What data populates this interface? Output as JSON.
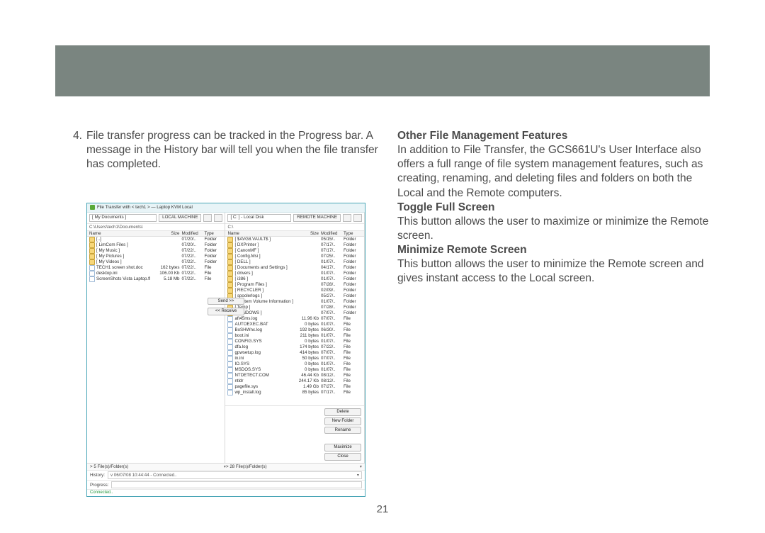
{
  "page_number": "21",
  "left_column": {
    "step_number": "4.",
    "step_text": "File transfer progress can be tracked in the Progress bar. A message in the History bar will tell you when the file transfer has completed."
  },
  "right_column": {
    "h1": "Other File Management Features",
    "p1": "In addition to File Transfer, the GCS661U's User Interface also offers a full range of file system management features, such as creating, renaming, and deleting files and folders on both the Local and the Remote computers.",
    "h2": "Toggle Full Screen",
    "p2": "This button allows the user to maximize or minimize the Remote screen.",
    "h3": "Minimize Remote Screen",
    "p3": "This button allows the user to minimize the Remote screen and gives instant access to the Local screen."
  },
  "screenshot": {
    "title": "File Transfer with < tech1 > — Laptop KVM Local",
    "headers": {
      "name": "Name",
      "size": "Size",
      "modified": "Modified",
      "type": "Type"
    },
    "center_buttons": {
      "send": "Send >>",
      "receive": "<< Receive"
    },
    "right_buttons": {
      "delete_top": "Delete",
      "newfolder": "New Folder",
      "rename": "Rename",
      "maximize": "Maximize",
      "close": "Close"
    },
    "local": {
      "dropdown": "[ My Documents ]",
      "machine_label": "LOCAL MACHINE",
      "path": "C:\\Users\\tech1\\Documents\\",
      "rows": [
        {
          "name": "[..]",
          "size": "",
          "mod": "07/20/..",
          "type": "Folder",
          "icon": "up"
        },
        {
          "name": "[ LimCom Files ]",
          "size": "",
          "mod": "07/20/..",
          "type": "Folder",
          "icon": "folder"
        },
        {
          "name": "[ My Music ]",
          "size": "",
          "mod": "07/22/..",
          "type": "Folder",
          "icon": "folder"
        },
        {
          "name": "[ My Pictures ]",
          "size": "",
          "mod": "07/22/..",
          "type": "Folder",
          "icon": "folder"
        },
        {
          "name": "[ My Videos ]",
          "size": "",
          "mod": "07/22/..",
          "type": "Folder",
          "icon": "folder"
        },
        {
          "name": "TECH1 screen shot.doc",
          "size": "162 bytes",
          "mod": "07/22/..",
          "type": "File",
          "icon": "file"
        },
        {
          "name": "desktop.ini",
          "size": "106.00 Kb",
          "mod": "07/22/..",
          "type": "File",
          "icon": "file"
        },
        {
          "name": "ScreenShots Vista Laptop.fl",
          "size": "5.18 Mb",
          "mod": "07/22/..",
          "type": "File",
          "icon": "file"
        }
      ],
      "status": "> 5 File(s)/Folder(s)"
    },
    "remote": {
      "dropdown": "[ C: ] - Local Disk",
      "machine_label": "REMOTE MACHINE",
      "path": "C:\\",
      "rows": [
        {
          "name": "[ $AVG8.VAULT$ ]",
          "size": "",
          "mod": "05/15/..",
          "type": "Folder",
          "icon": "folder"
        },
        {
          "name": "[ DXPrinter ]",
          "size": "",
          "mod": "07/17/..",
          "type": "Folder",
          "icon": "folder"
        },
        {
          "name": "[ CanonMF ]",
          "size": "",
          "mod": "07/17/..",
          "type": "Folder",
          "icon": "folder"
        },
        {
          "name": "[ Config.Msi ]",
          "size": "",
          "mod": "07/25/..",
          "type": "Folder",
          "icon": "folder"
        },
        {
          "name": "[ DELL ]",
          "size": "",
          "mod": "01/07/..",
          "type": "Folder",
          "icon": "folder"
        },
        {
          "name": "[ Documents and Settings ]",
          "size": "",
          "mod": "04/17/..",
          "type": "Folder",
          "icon": "folder"
        },
        {
          "name": "[ drivers ]",
          "size": "",
          "mod": "01/07/..",
          "type": "Folder",
          "icon": "folder"
        },
        {
          "name": "[ i386 ]",
          "size": "",
          "mod": "01/07/..",
          "type": "Folder",
          "icon": "folder"
        },
        {
          "name": "[ Program Files ]",
          "size": "",
          "mod": "07/28/..",
          "type": "Folder",
          "icon": "folder"
        },
        {
          "name": "[ RECYCLER ]",
          "size": "",
          "mod": "02/09/..",
          "type": "Folder",
          "icon": "folder"
        },
        {
          "name": "[ spoolerlogs ]",
          "size": "",
          "mod": "05/27/..",
          "type": "Folder",
          "icon": "folder"
        },
        {
          "name": "[ System Volume Information ]",
          "size": "",
          "mod": "01/07/..",
          "type": "Folder",
          "icon": "folder"
        },
        {
          "name": "[ Temp ]",
          "size": "",
          "mod": "07/28/..",
          "type": "Folder",
          "icon": "folder"
        },
        {
          "name": "[ WINDOWS ]",
          "size": "",
          "mod": "07/07/..",
          "type": "Folder",
          "icon": "folder"
        },
        {
          "name": "aft45ms.log",
          "size": "11.96 Kb",
          "mod": "07/07/..",
          "type": "File",
          "icon": "file"
        },
        {
          "name": "AUTOEXEC.BAT",
          "size": "0 bytes",
          "mod": "01/07/..",
          "type": "File",
          "icon": "file"
        },
        {
          "name": "BoSHWnx.log",
          "size": "192 bytes",
          "mod": "06/30/..",
          "type": "File",
          "icon": "file"
        },
        {
          "name": "boot.ini",
          "size": "211 bytes",
          "mod": "01/07/..",
          "type": "File",
          "icon": "file"
        },
        {
          "name": "CONFIG.SYS",
          "size": "0 bytes",
          "mod": "01/07/..",
          "type": "File",
          "icon": "file"
        },
        {
          "name": "dfa.log",
          "size": "174 bytes",
          "mod": "07/22/..",
          "type": "File",
          "icon": "file"
        },
        {
          "name": "gpwsetup.log",
          "size": "414 bytes",
          "mod": "07/07/..",
          "type": "File",
          "icon": "file"
        },
        {
          "name": "in.ini",
          "size": "50 bytes",
          "mod": "07/07/..",
          "type": "File",
          "icon": "file"
        },
        {
          "name": "IO.SYS",
          "size": "0 bytes",
          "mod": "01/07/..",
          "type": "File",
          "icon": "file"
        },
        {
          "name": "MSDOS.SYS",
          "size": "0 bytes",
          "mod": "01/07/..",
          "type": "File",
          "icon": "file"
        },
        {
          "name": "NTDETECT.COM",
          "size": "46.44 Kb",
          "mod": "08/12/..",
          "type": "File",
          "icon": "file"
        },
        {
          "name": "ntldr",
          "size": "244.17 Kb",
          "mod": "08/12/..",
          "type": "File",
          "icon": "file"
        },
        {
          "name": "pagefile.sys",
          "size": "1.49 Gb",
          "mod": "07/27/..",
          "type": "File",
          "icon": "file"
        },
        {
          "name": "wp_install.log",
          "size": "85 bytes",
          "mod": "07/17/..",
          "type": "File",
          "icon": "file"
        }
      ],
      "status": "> 28 File(s)/Folder(s)"
    },
    "history_label": "History:",
    "history_value": "v 06/07/08 10:44:44 - Connected..",
    "progress_label": "Progress:",
    "connected": "Connected.."
  }
}
